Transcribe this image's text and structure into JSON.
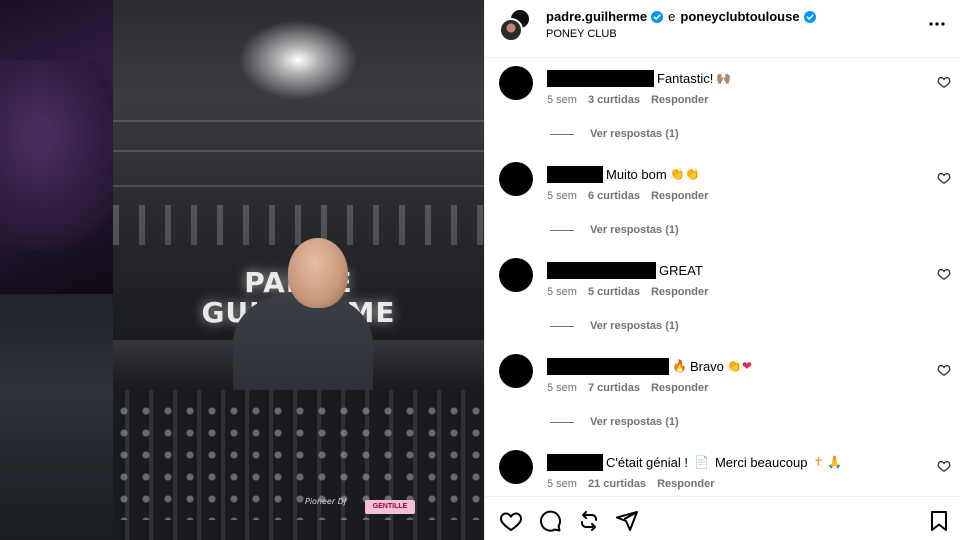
{
  "video": {
    "title_text": "PADRE\nGUILHERME",
    "mixer_brand": "Pioneer DJ",
    "sticker_text": "GENTILLE"
  },
  "header": {
    "user1": "padre.guilherme",
    "conjunction": "e",
    "user2": "poneyclubtoulouse",
    "location": "PONEY CLUB",
    "more_icon": "more-horizontal-icon"
  },
  "comments": [
    {
      "text": "Fantastic!",
      "emoji": "🙌🏽",
      "time": "5 sem",
      "likes": "3 curtidas",
      "reply": "Responder",
      "view_replies": "Ver respostas (1)"
    },
    {
      "text": "Muito bom",
      "emoji": "👏👏",
      "time": "5 sem",
      "likes": "6 curtidas",
      "reply": "Responder",
      "view_replies": "Ver respostas (1)"
    },
    {
      "text": "GREAT",
      "emoji": "",
      "time": "5 sem",
      "likes": "5 curtidas",
      "reply": "Responder",
      "view_replies": "Ver respostas (1)"
    },
    {
      "text": "Bravo",
      "emoji_before": "🔥",
      "emoji": "👏❤",
      "time": "5 sem",
      "likes": "7 curtidas",
      "reply": "Responder",
      "view_replies": "Ver respostas (1)"
    },
    {
      "text": "C'était génial !",
      "emoji_mid": "📄",
      "text2": "Merci beaucoup",
      "emoji": "✝ 🙏",
      "time": "5 sem",
      "likes": "21 curtidas",
      "reply": "Responder"
    }
  ],
  "actions": {
    "like": "heart-icon",
    "comment": "comment-icon",
    "share": "repost-icon",
    "send": "send-icon",
    "save": "bookmark-icon"
  },
  "colors": {
    "verified": "#0095f6",
    "meta_text": "#737373",
    "divider": "#efefef"
  }
}
